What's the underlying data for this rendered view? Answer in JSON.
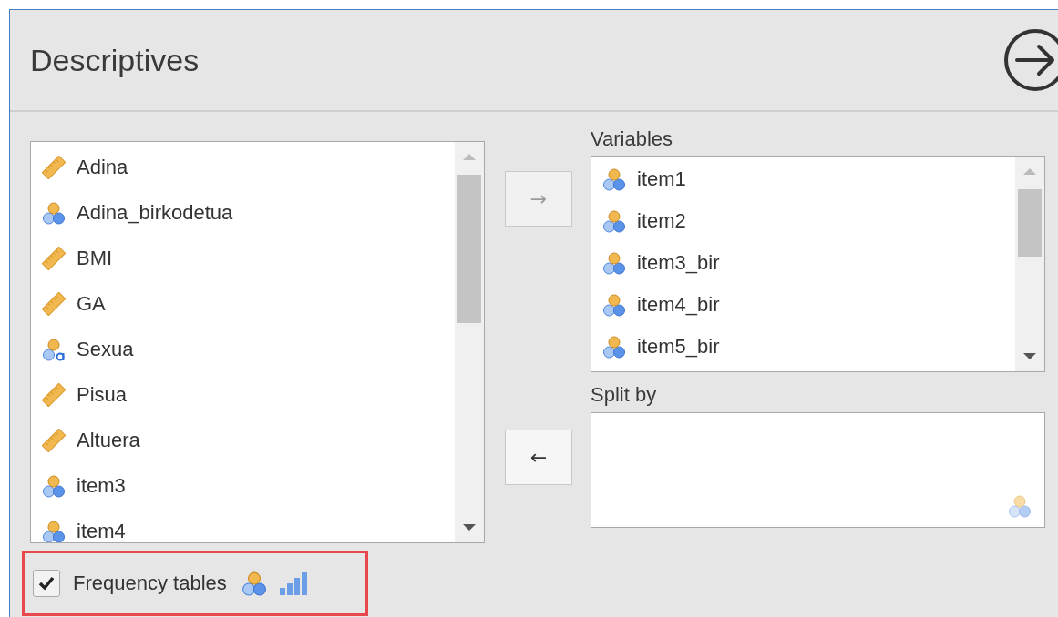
{
  "panel": {
    "title": "Descriptives"
  },
  "source_list": {
    "items": [
      {
        "name": "Adina",
        "kind": "continuous"
      },
      {
        "name": "Adina_birkodetua",
        "kind": "nominal"
      },
      {
        "name": "BMI",
        "kind": "continuous"
      },
      {
        "name": "GA",
        "kind": "continuous"
      },
      {
        "name": "Sexua",
        "kind": "nominaltext"
      },
      {
        "name": "Pisua",
        "kind": "continuous"
      },
      {
        "name": "Altuera",
        "kind": "continuous"
      },
      {
        "name": "item3",
        "kind": "nominal"
      },
      {
        "name": "item4",
        "kind": "nominal"
      }
    ]
  },
  "move_buttons": [
    {
      "label": "→",
      "disabled": true
    },
    {
      "label": "←",
      "disabled": false
    }
  ],
  "variables": {
    "label": "Variables",
    "items": [
      {
        "name": "item1",
        "kind": "nominal"
      },
      {
        "name": "item2",
        "kind": "nominal"
      },
      {
        "name": "item3_bir",
        "kind": "nominal"
      },
      {
        "name": "item4_bir",
        "kind": "nominal"
      },
      {
        "name": "item5_bir",
        "kind": "nominal"
      }
    ]
  },
  "split_by": {
    "label": "Split by"
  },
  "frequency_tables": {
    "label": "Frequency tables",
    "checked": true,
    "highlighted": true
  }
}
